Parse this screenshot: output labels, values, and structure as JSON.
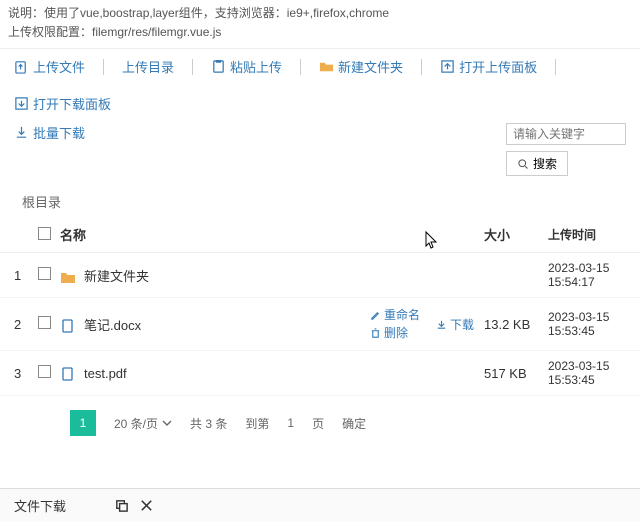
{
  "notes": {
    "line1": "说明：使用了vue,boostrap,layer组件，支持浏览器：ie9+,firefox,chrome",
    "line2": "上传权限配置：filemgr/res/filemgr.vue.js"
  },
  "toolbar": {
    "upload_file": "上传文件",
    "upload_dir": "上传目录",
    "paste_upload": "粘贴上传",
    "new_folder": "新建文件夹",
    "open_upload_panel": "打开上传面板",
    "open_download_panel": "打开下载面板",
    "batch_download": "批量下载"
  },
  "search": {
    "placeholder": "请输入关键字",
    "button": "搜索"
  },
  "breadcrumb": "根目录",
  "columns": {
    "name": "名称",
    "size": "大小",
    "time": "上传时间"
  },
  "rows": [
    {
      "idx": "1",
      "icon": "folder",
      "name": "新建文件夹",
      "size": "",
      "time": "2023-03-15 15:54:17",
      "actions": false
    },
    {
      "idx": "2",
      "icon": "file",
      "name": "笔记.docx",
      "size": "13.2 KB",
      "time": "2023-03-15 15:53:45",
      "actions": true
    },
    {
      "idx": "3",
      "icon": "file",
      "name": "test.pdf",
      "size": "517 KB",
      "time": "2023-03-15 15:53:45",
      "actions": false
    }
  ],
  "row_actions": {
    "rename": "重命名",
    "delete": "删除",
    "download": "下载"
  },
  "pager": {
    "current": "1",
    "page_size": "20 条/页",
    "total": "共 3 条",
    "jump_label": "到第",
    "jump_value": "1",
    "page_unit": "页",
    "confirm": "确定"
  },
  "bottom": {
    "title": "文件下载"
  },
  "colors": {
    "link": "#337ab7",
    "accent": "#1abc9c",
    "folder": "#f0ad4e"
  }
}
